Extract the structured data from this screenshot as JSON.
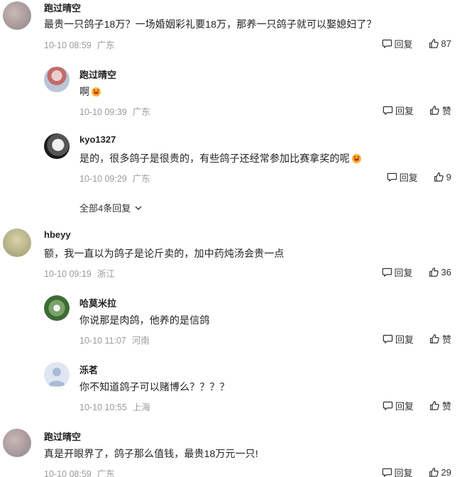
{
  "comments": [
    {
      "author": "跑过晴空",
      "text": "最贵一只鸽子18万？一场婚姻彩礼要18万，那养一只鸽子就可以娶媳妇了？",
      "time": "10-10 08:59",
      "location": "广东",
      "reply_label": "回复",
      "like_label": "87"
    },
    {
      "author": "跑过晴空",
      "text": "啊",
      "time": "10-10 09:39",
      "location": "广东",
      "reply_label": "回复",
      "like_label": "赞"
    },
    {
      "author": "kyo1327",
      "text": "是的，很多鸽子是很贵的，有些鸽子还经常参加比赛拿奖的呢",
      "time": "10-10 09:29",
      "location": "广东",
      "reply_label": "回复",
      "like_label": "9"
    },
    {
      "author": "hbeyy",
      "text": "额，我一直以为鸽子是论斤卖的，加中药炖汤会贵一点",
      "time": "10-10 09:19",
      "location": "浙江",
      "reply_label": "回复",
      "like_label": "36"
    },
    {
      "author": "哈莫米拉",
      "text": "你说那是肉鸽，他养的是信鸽",
      "time": "10-10 11:07",
      "location": "河南",
      "reply_label": "回复",
      "like_label": "赞"
    },
    {
      "author": "泺茗",
      "text": "你不知道鸽子可以赌博么？？？？",
      "time": "10-10 10:55",
      "location": "上海",
      "reply_label": "回复",
      "like_label": "赞"
    },
    {
      "author": "跑过晴空",
      "text": "真是开眼界了，鸽子那么值钱，最贵18万元一只!",
      "time": "10-10 08:59",
      "location": "广东",
      "reply_label": "回复",
      "like_label": "29"
    }
  ],
  "expand_replies": "全部4条回复",
  "colors": {
    "text": "#222222",
    "meta": "#9a9a9a",
    "emoji": "#f7b42c"
  }
}
